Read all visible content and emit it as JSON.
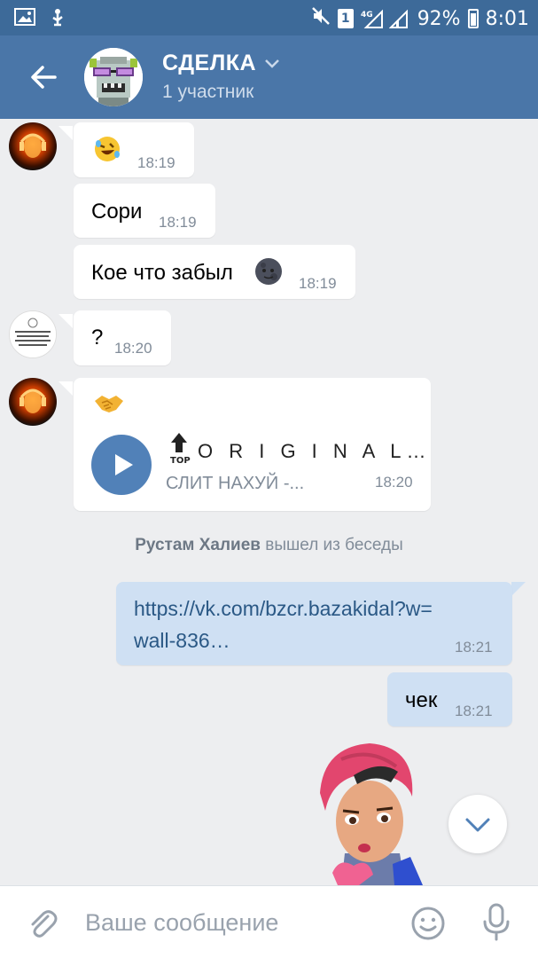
{
  "status_bar": {
    "sim_slot": "1",
    "network": "4G",
    "battery": "92%",
    "time": "8:01"
  },
  "header": {
    "title": "СДЕЛКА",
    "subtitle": "1 участник"
  },
  "messages": [
    {
      "text": "",
      "emoji": "rofl",
      "time": "18:19"
    },
    {
      "text": "Сори",
      "time": "18:19"
    },
    {
      "text": "Кое что забыл",
      "emoji": "new-moon-face",
      "time": "18:19"
    },
    {
      "text": "?",
      "time": "18:20"
    },
    {
      "emoji": "handshake",
      "time": "18:20",
      "audio": {
        "title": "O R I G I N A L…",
        "artist": "СЛИТ НАХУЙ -...",
        "badge": "TOP"
      }
    },
    {
      "text": "https://vk.com/bzcr.bazakidal?w=wall-836…",
      "time": "18:21"
    },
    {
      "text": "чек",
      "time": "18:21"
    }
  ],
  "system_message": {
    "name": "Рустам Халиев",
    "action": "вышел из беседы"
  },
  "link_lines": [
    "https://vk.com/bzcr.bazakidal?w=",
    "wall-836…"
  ],
  "composer": {
    "placeholder": "Ваше сообщение"
  },
  "colors": {
    "header": "#4a76a8",
    "status_bar": "#3d6a99",
    "background": "#edeef0",
    "outgoing_bubble": "#cfe0f3",
    "link": "#2a5885",
    "accent": "#5181b8"
  }
}
